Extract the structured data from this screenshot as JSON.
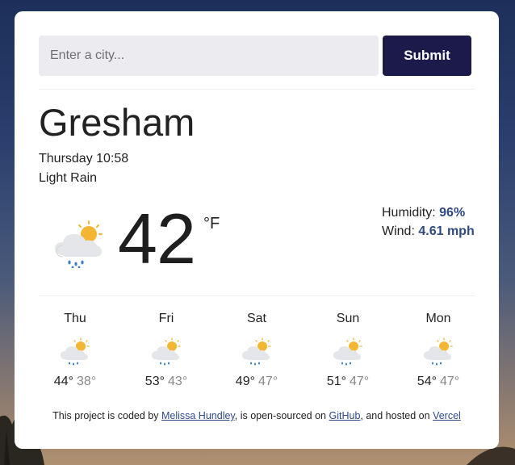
{
  "search": {
    "placeholder": "Enter a city...",
    "value": "",
    "submit_label": "Submit"
  },
  "current": {
    "city": "Gresham",
    "datetime": "Thursday 10:58",
    "description": "Light Rain",
    "temperature": "42",
    "unit": "°F",
    "icon": "cloud-sun-rain-icon",
    "humidity_label": "Humidity:",
    "humidity_value": "96%",
    "wind_label": "Wind:",
    "wind_value": "4.61 mph"
  },
  "forecast": [
    {
      "day": "Thu",
      "high": "44°",
      "low": "38°",
      "icon": "cloud-sun-rain-icon"
    },
    {
      "day": "Fri",
      "high": "53°",
      "low": "43°",
      "icon": "cloud-sun-rain-icon"
    },
    {
      "day": "Sat",
      "high": "49°",
      "low": "47°",
      "icon": "cloud-sun-rain-icon"
    },
    {
      "day": "Sun",
      "high": "51°",
      "low": "47°",
      "icon": "cloud-sun-rain-icon"
    },
    {
      "day": "Mon",
      "high": "54°",
      "low": "47°",
      "icon": "cloud-sun-rain-icon"
    }
  ],
  "footer": {
    "text_1": "This project is coded by",
    "author_link": "Melissa Hundley",
    "text_2": ", is open-sourced on",
    "github_link": "GitHub",
    "text_3": ", and hosted on",
    "vercel_link": "Vercel"
  },
  "colors": {
    "accent": "#1b1a4b",
    "value_text": "#2e4a80",
    "input_bg": "#ebebf0",
    "sun": "#f2b632"
  }
}
